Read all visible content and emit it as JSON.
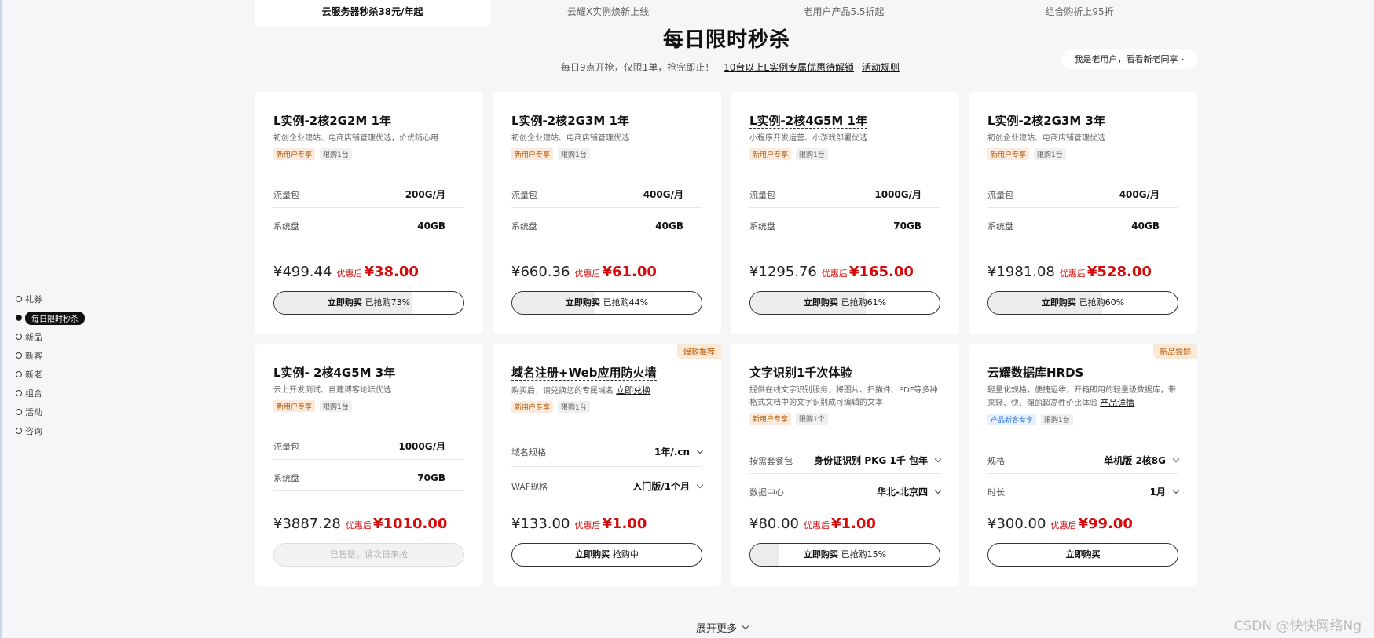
{
  "top_tabs": [
    {
      "label": "云服务器秒杀38元/年起",
      "active": true
    },
    {
      "label": "云耀X实例焕新上线",
      "active": false
    },
    {
      "label": "老用户产品5.5折起",
      "active": false
    },
    {
      "label": "组合购折上95折",
      "active": false
    }
  ],
  "heading": {
    "title": "每日限时秒杀",
    "subtitle": "每日9点开抢，仅限1单，抢完即止！",
    "link1": "10台以上L实例专属优惠待解锁",
    "link2": "活动规则",
    "old_user_button": "我是老用户，看看新老同享 ›"
  },
  "side_nav": [
    {
      "label": "礼券",
      "active": false
    },
    {
      "label": "每日限时秒杀",
      "active": true
    },
    {
      "label": "新品",
      "active": false
    },
    {
      "label": "新客",
      "active": false
    },
    {
      "label": "新老",
      "active": false
    },
    {
      "label": "组合",
      "active": false
    },
    {
      "label": "活动",
      "active": false
    },
    {
      "label": "咨询",
      "active": false
    }
  ],
  "cards": [
    {
      "title": "L实例-2核2G2M 1年",
      "desc": "初创企业建站、电商店铺管理优选，价优随心用",
      "tags": [
        "新用户专享",
        "限购1台"
      ],
      "specs": [
        {
          "label": "流量包",
          "value": "200G/月"
        },
        {
          "label": "系统盘",
          "value": "40GB"
        }
      ],
      "orig_price": "¥499.44",
      "after_label": "优惠后",
      "deal_price": "¥38.00",
      "buy_label": "立即购买",
      "buy_status": "已抢购73%",
      "progress": 0.73
    },
    {
      "title": "L实例-2核2G3M 1年",
      "desc": "初创企业建站、电商店铺管理优选",
      "tags": [
        "新用户专享",
        "限购1台"
      ],
      "specs": [
        {
          "label": "流量包",
          "value": "400G/月"
        },
        {
          "label": "系统盘",
          "value": "40GB"
        }
      ],
      "orig_price": "¥660.36",
      "after_label": "优惠后",
      "deal_price": "¥61.00",
      "buy_label": "立即购买",
      "buy_status": "已抢购44%",
      "progress": 0.44
    },
    {
      "title": "L实例-2核4G5M 1年",
      "desc": "小程序开发运营、小游戏部署优选",
      "tags": [
        "新用户专享",
        "限购1台"
      ],
      "specs": [
        {
          "label": "流量包",
          "value": "1000G/月"
        },
        {
          "label": "系统盘",
          "value": "70GB"
        }
      ],
      "orig_price": "¥1295.76",
      "after_label": "优惠后",
      "deal_price": "¥165.00",
      "buy_label": "立即购买",
      "buy_status": "已抢购61%",
      "progress": 0.61
    },
    {
      "title": "L实例-2核2G3M 3年",
      "desc": "初创企业建站、电商店铺管理优选",
      "tags": [
        "新用户专享",
        "限购1台"
      ],
      "specs": [
        {
          "label": "流量包",
          "value": "400G/月"
        },
        {
          "label": "系统盘",
          "value": "40GB"
        }
      ],
      "orig_price": "¥1981.08",
      "after_label": "优惠后",
      "deal_price": "¥528.00",
      "buy_label": "立即购买",
      "buy_status": "已抢购60%",
      "progress": 0.6
    },
    {
      "title": "L实例- 2核4G5M 3年",
      "desc": "云上开发测试、自建博客论坛优选",
      "tags": [
        "新用户专享",
        "限购1台"
      ],
      "specs": [
        {
          "label": "流量包",
          "value": "1000G/月"
        },
        {
          "label": "系统盘",
          "value": "70GB"
        }
      ],
      "orig_price": "¥3887.28",
      "after_label": "优惠后",
      "deal_price": "¥1010.00",
      "buy_label": "已售罄，请次日来抢",
      "buy_status": "",
      "sold_out": true
    },
    {
      "corner": "爆款推荐",
      "title": "域名注册+Web应用防火墙",
      "desc": "购买后，请兑换您的专属域名",
      "desc_link": "立即兑换",
      "tags": [
        "新用户专享",
        "限购1台"
      ],
      "selects": [
        {
          "label": "域名规格",
          "value": "1年/.cn"
        },
        {
          "label": "WAF规格",
          "value": "入门版/1个月"
        }
      ],
      "orig_price": "¥133.00",
      "after_label": "优惠后",
      "deal_price": "¥1.00",
      "buy_label": "立即购买",
      "buy_status": "抢购中",
      "progress": 0
    },
    {
      "title": "文字识别1千次体验",
      "desc": "提供在线文字识别服务，将图片、扫描件、PDF等多种格式文档中的文字识别成可编辑的文本",
      "tags": [
        "新用户专享",
        "限购1个"
      ],
      "selects": [
        {
          "label": "按需套餐包",
          "value": "身份证识别 PKG 1千 包年"
        },
        {
          "label": "数据中心",
          "value": "华北-北京四"
        }
      ],
      "orig_price": "¥80.00",
      "after_label": "优惠后",
      "deal_price": "¥1.00",
      "buy_label": "立即购买",
      "buy_status": "已抢购15%",
      "progress": 0.15
    },
    {
      "corner": "新品尝鲜",
      "title": "云耀数据库HRDS",
      "desc": "轻量化规格，便捷运维，开箱即用的轻量级数据库，带来轻、快、强的超高性价比体验",
      "desc_link": "产品详情",
      "tags": [
        "产品新客专享",
        "限购1台"
      ],
      "selects": [
        {
          "label": "规格",
          "value": "单机版 2核8G"
        },
        {
          "label": "时长",
          "value": "1月"
        }
      ],
      "orig_price": "¥300.00",
      "after_label": "优惠后",
      "deal_price": "¥99.00",
      "buy_label": "立即购买",
      "buy_status": "",
      "progress": 0
    }
  ],
  "more_label": "展开更多",
  "watermark": "CSDN @快快网络Ng"
}
